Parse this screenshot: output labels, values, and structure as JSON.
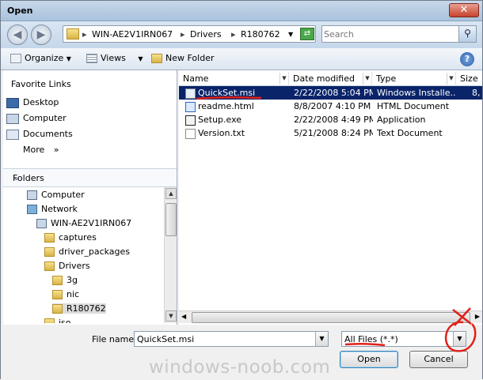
{
  "window": {
    "title": "Open",
    "close_glyph": "✕"
  },
  "address": {
    "crumbs": [
      "WIN-AE2V1IRN067",
      "Drivers",
      "R180762"
    ],
    "separator": "▸",
    "search_placeholder": "Search"
  },
  "toolbar": {
    "organize": "Organize",
    "views": "Views",
    "new_folder": "New Folder",
    "help": "?"
  },
  "favorites": {
    "title": "Favorite Links",
    "items": [
      "Desktop",
      "Computer",
      "Documents",
      "More"
    ],
    "more_glyph": "»"
  },
  "folders": {
    "title": "Folders",
    "tree": [
      "Computer",
      "Network",
      "WIN-AE2V1IRN067",
      "captures",
      "driver_packages",
      "Drivers",
      "3g",
      "nic",
      "R180762",
      "iso"
    ]
  },
  "columns": [
    "Name",
    "Date modified",
    "Type",
    "Size"
  ],
  "files": [
    {
      "name": "QuickSet.msi",
      "date": "2/22/2008 5:04 PM",
      "type": "Windows Installe...",
      "size": "8,",
      "icon": "msi-icon",
      "selected": true
    },
    {
      "name": "readme.html",
      "date": "8/8/2007 4:10 PM",
      "type": "HTML Document",
      "size": "",
      "icon": "html-icon",
      "selected": false
    },
    {
      "name": "Setup.exe",
      "date": "2/22/2008 4:49 PM",
      "type": "Application",
      "size": "",
      "icon": "exe-icon",
      "selected": false
    },
    {
      "name": "Version.txt",
      "date": "5/21/2008 8:24 PM",
      "type": "Text Document",
      "size": "",
      "icon": "txt-icon",
      "selected": false
    }
  ],
  "bottom": {
    "file_name_label": "File name:",
    "file_name_value": "QuickSet.msi",
    "file_type_value": "All Files (*.*)",
    "open": "Open",
    "cancel": "Cancel"
  },
  "watermark": "windows-noob.com",
  "colors": {
    "selection": "#0a246a",
    "annotation": "#e0201a"
  }
}
